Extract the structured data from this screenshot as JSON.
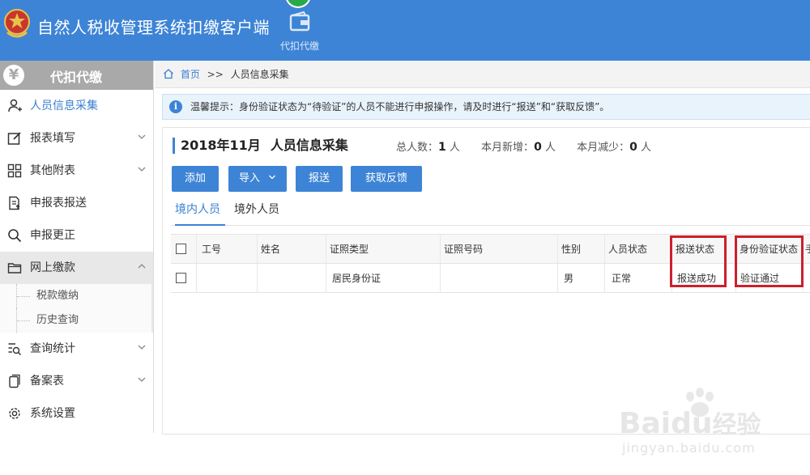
{
  "app": {
    "title": "自然人税收管理系统扣缴客户端"
  },
  "top_nav": {
    "label": "代扣代缴"
  },
  "sidebar": {
    "header": "代扣代缴",
    "items": [
      {
        "label": "人员信息采集"
      },
      {
        "label": "报表填写"
      },
      {
        "label": "其他附表"
      },
      {
        "label": "申报表报送"
      },
      {
        "label": "申报更正"
      },
      {
        "label": "网上缴款",
        "children": [
          {
            "label": "税款缴纳"
          },
          {
            "label": "历史查询"
          }
        ]
      },
      {
        "label": "查询统计"
      },
      {
        "label": "备案表"
      },
      {
        "label": "系统设置"
      }
    ]
  },
  "breadcrumb": {
    "home": "首页",
    "sep": ">>",
    "current": "人员信息采集"
  },
  "notice": {
    "text": "温馨提示：身份验证状态为“待验证”的人员不能进行申报操作，请及时进行“报送”和“获取反馈”。"
  },
  "panel": {
    "period": "2018年11月",
    "title": "人员信息采集",
    "stats": [
      {
        "label": "总人数：",
        "value": "1",
        "unit": " 人"
      },
      {
        "label": "本月新增：",
        "value": "0",
        "unit": " 人"
      },
      {
        "label": "本月减少：",
        "value": "0",
        "unit": " 人"
      }
    ]
  },
  "toolbar": {
    "add": "添加",
    "import": "导入",
    "submit": "报送",
    "feedback": "获取反馈"
  },
  "tabs": [
    {
      "label": "境内人员"
    },
    {
      "label": "境外人员"
    }
  ],
  "table": {
    "columns": [
      "工号",
      "姓名",
      "证照类型",
      "证照号码",
      "性别",
      "人员状态",
      "报送状态",
      "身份验证状态",
      "手"
    ],
    "rows": [
      {
        "id_no": "",
        "name": "",
        "id_type": "居民身份证",
        "id_number": "",
        "gender": "男",
        "status": "正常",
        "submit_status": "报送成功",
        "verify_status": "验证通过"
      }
    ]
  },
  "watermark": {
    "brand": "Bai",
    "brand2": "du",
    "brand3": "经验",
    "url": "jingyan.baidu.com"
  },
  "colors": {
    "header": "#3d84d6",
    "accent": "#3d84d6",
    "highlight": "#cc1f2c",
    "sidebar_head": "#a9a9a9"
  }
}
